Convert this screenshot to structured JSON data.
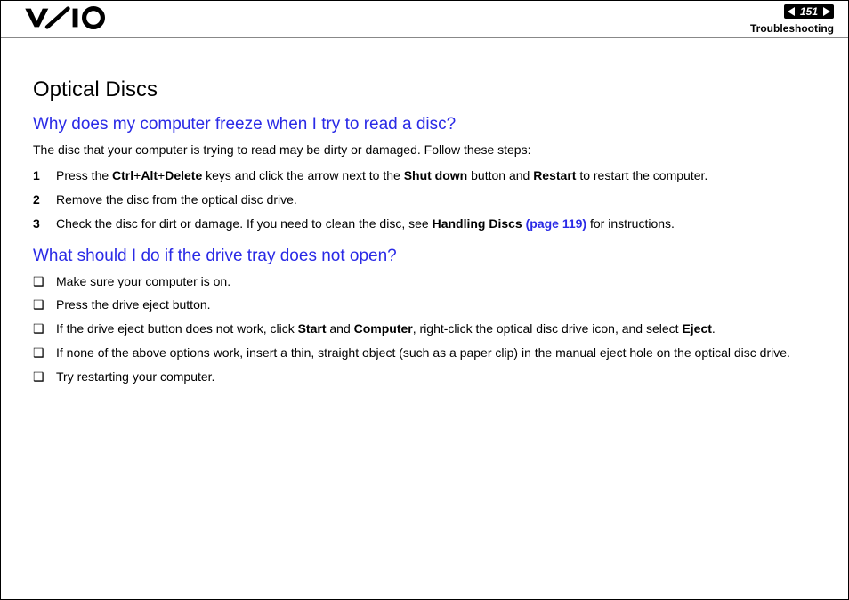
{
  "header": {
    "page_number": "151",
    "section": "Troubleshooting",
    "logo_alt": "VAIO"
  },
  "title": "Optical Discs",
  "q1": {
    "heading": "Why does my computer freeze when I try to read a disc?",
    "intro": "The disc that your computer is trying to read may be dirty or damaged. Follow these steps:",
    "steps": [
      {
        "n": "1",
        "pre": "Press the ",
        "b1": "Ctrl",
        "plus1": "+",
        "b2": "Alt",
        "plus2": "+",
        "b3": "Delete",
        "mid1": " keys and click the arrow next to the ",
        "b4": "Shut down",
        "mid2": " button and ",
        "b5": "Restart",
        "post": " to restart the computer."
      },
      {
        "n": "2",
        "text": "Remove the disc from the optical disc drive."
      },
      {
        "n": "3",
        "pre": "Check the disc for dirt or damage. If you need to clean the disc, see ",
        "b1": "Handling Discs ",
        "link": "(page 119)",
        "post": " for instructions."
      }
    ]
  },
  "q2": {
    "heading": "What should I do if the drive tray does not open?",
    "bullets": [
      {
        "text": "Make sure your computer is on."
      },
      {
        "text": "Press the drive eject button."
      },
      {
        "pre": "If the drive eject button does not work, click ",
        "b1": "Start",
        "mid1": " and ",
        "b2": "Computer",
        "mid2": ", right-click the optical disc drive icon, and select ",
        "b3": "Eject",
        "post": "."
      },
      {
        "text": "If none of the above options work, insert a thin, straight object (such as a paper clip) in the manual eject hole on the optical disc drive."
      },
      {
        "text": "Try restarting your computer."
      }
    ]
  },
  "bullet_glyph": "❑"
}
